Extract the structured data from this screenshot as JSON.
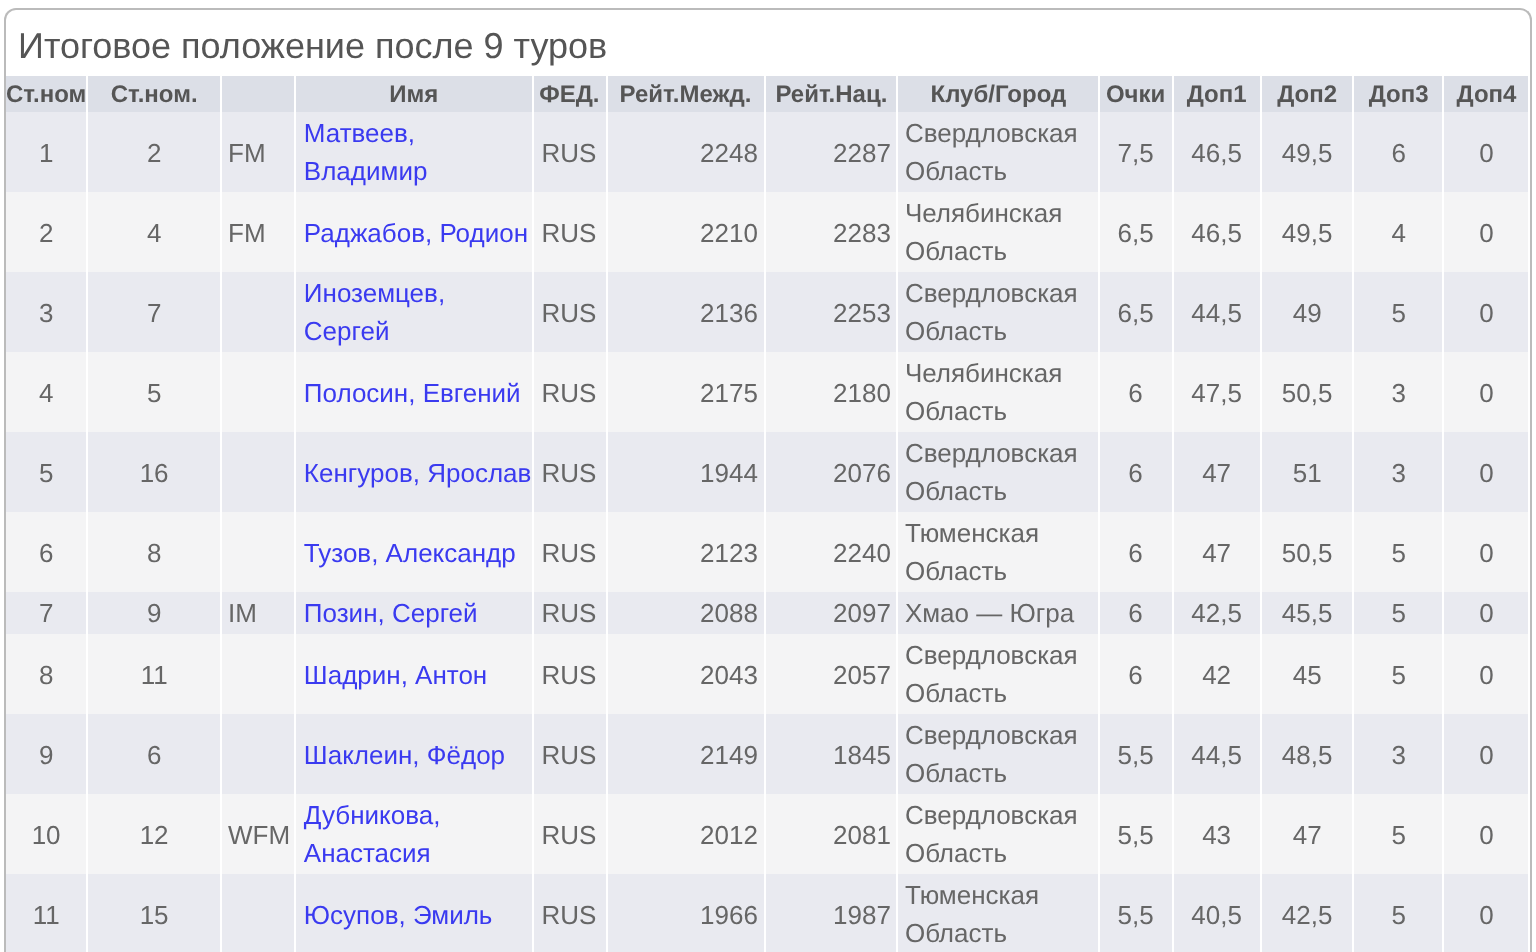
{
  "title": "Итоговое положение после 9 туров",
  "table": {
    "columns": [
      "Ст.ном",
      "Ст.ном.",
      "Имя",
      "ФЕД.",
      "Рейт.Межд.",
      "Рейт.Нац.",
      "Клуб/Город",
      "Очки",
      "Доп1",
      "Доп2",
      "Доп3",
      "Доп4"
    ],
    "rows": [
      {
        "rank": "1",
        "start_no": "2",
        "column_3": "FM",
        "name": "Матвеев, Владимир",
        "fed": "RUS",
        "rating_intl": "2248",
        "rating_nat": "2287",
        "club": "Свердловская Область",
        "points": "7,5",
        "tb1": "46,5",
        "tb2": "49,5",
        "tb3": "6",
        "tb4": "0"
      },
      {
        "rank": "2",
        "start_no": "4",
        "column_3": "FM",
        "name": "Раджабов, Родион",
        "fed": "RUS",
        "rating_intl": "2210",
        "rating_nat": "2283",
        "club": "Челябинская Область",
        "points": "6,5",
        "tb1": "46,5",
        "tb2": "49,5",
        "tb3": "4",
        "tb4": "0"
      },
      {
        "rank": "3",
        "start_no": "7",
        "name": "Иноземцев, Сергей",
        "fed": "RUS",
        "rating_intl": "2136",
        "rating_nat": "2253",
        "club": "Свердловская Область",
        "points": "6,5",
        "tb1": "44,5",
        "tb2": "49",
        "tb3": "5",
        "tb4": "0"
      },
      {
        "rank": "4",
        "start_no": "5",
        "name": "Полосин, Евгений",
        "fed": "RUS",
        "rating_intl": "2175",
        "rating_nat": "2180",
        "club": "Челябинская Область",
        "points": "6",
        "tb1": "47,5",
        "tb2": "50,5",
        "tb3": "3",
        "tb4": "0"
      },
      {
        "rank": "5",
        "start_no": "16",
        "name": "Кенгуров, Ярослав",
        "fed": "RUS",
        "rating_intl": "1944",
        "rating_nat": "2076",
        "club": "Свердловская Область",
        "points": "6",
        "tb1": "47",
        "tb2": "51",
        "tb3": "3",
        "tb4": "0"
      },
      {
        "rank": "6",
        "start_no": "8",
        "name": "Тузов, Александр",
        "fed": "RUS",
        "rating_intl": "2123",
        "rating_nat": "2240",
        "club": "Тюменская Область",
        "points": "6",
        "tb1": "47",
        "tb2": "50,5",
        "tb3": "5",
        "tb4": "0"
      },
      {
        "rank": "7",
        "start_no": "9",
        "column_3": "IM",
        "name": "Позин, Сергей",
        "fed": "RUS",
        "rating_intl": "2088",
        "rating_nat": "2097",
        "club": "Хмао — Югра",
        "points": "6",
        "tb1": "42,5",
        "tb2": "45,5",
        "tb3": "5",
        "tb4": "0"
      },
      {
        "rank": "8",
        "start_no": "11",
        "name": "Шадрин, Антон",
        "fed": "RUS",
        "rating_intl": "2043",
        "rating_nat": "2057",
        "club": "Свердловская Область",
        "points": "6",
        "tb1": "42",
        "tb2": "45",
        "tb3": "5",
        "tb4": "0"
      },
      {
        "rank": "9",
        "start_no": "6",
        "name": "Шаклеин, Фёдор",
        "fed": "RUS",
        "rating_intl": "2149",
        "rating_nat": "1845",
        "club": "Свердловская Область",
        "points": "5,5",
        "tb1": "44,5",
        "tb2": "48,5",
        "tb3": "3",
        "tb4": "0"
      },
      {
        "rank": "10",
        "start_no": "12",
        "column_3": "WFM",
        "name": "Дубникова, Анастасия",
        "fed": "RUS",
        "rating_intl": "2012",
        "rating_nat": "2081",
        "club": "Свердловская Область",
        "points": "5,5",
        "tb1": "43",
        "tb2": "47",
        "tb3": "5",
        "tb4": "0"
      },
      {
        "rank": "11",
        "start_no": "15",
        "name": "Юсупов, Эмиль",
        "fed": "RUS",
        "rating_intl": "1966",
        "rating_nat": "1987",
        "club": "Тюменская Область",
        "points": "5,5",
        "tb1": "40,5",
        "tb2": "42,5",
        "tb3": "5",
        "tb4": "0"
      }
    ]
  }
}
